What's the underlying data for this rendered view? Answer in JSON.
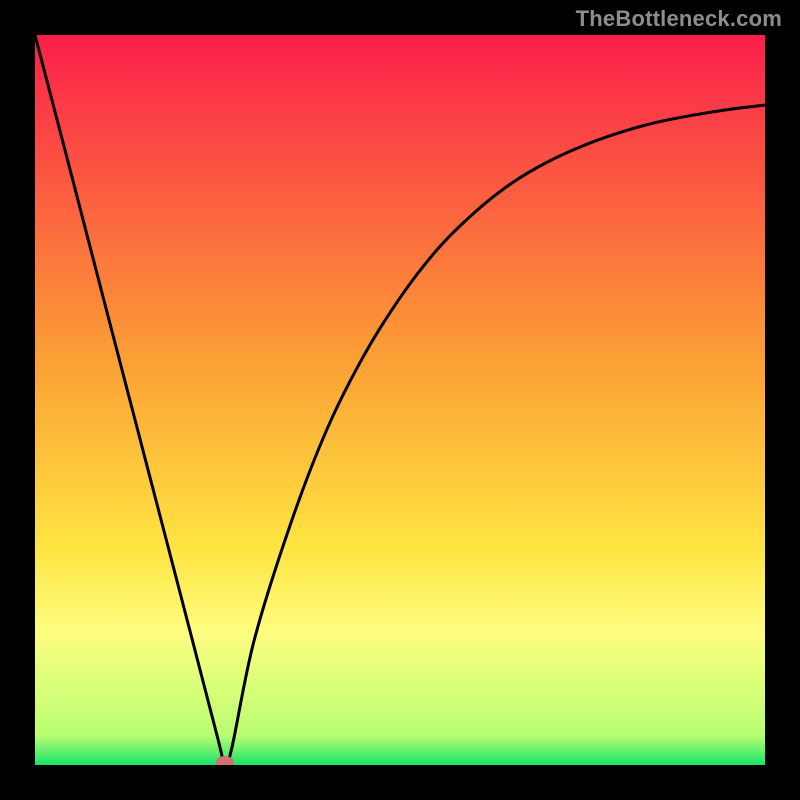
{
  "watermark": "TheBottleneck.com",
  "chart_data": {
    "type": "line",
    "title": "",
    "xlabel": "",
    "ylabel": "",
    "xlim": [
      0,
      100
    ],
    "ylim": [
      0,
      100
    ],
    "minimum_marker": {
      "x": 26,
      "y": 0,
      "color": "#d07070"
    },
    "background_gradient": {
      "stops": [
        {
          "pos": 0.0,
          "color": "#fb1f4b"
        },
        {
          "pos": 0.45,
          "color": "#fba135"
        },
        {
          "pos": 0.7,
          "color": "#ffe441"
        },
        {
          "pos": 0.82,
          "color": "#fdfd80"
        },
        {
          "pos": 0.96,
          "color": "#b8ff72"
        },
        {
          "pos": 1.0,
          "color": "#18e36a"
        }
      ]
    },
    "series": [
      {
        "name": "curve",
        "x": [
          0,
          5,
          10,
          15,
          20,
          25,
          26,
          27,
          30,
          35,
          40,
          45,
          50,
          55,
          60,
          65,
          70,
          75,
          80,
          85,
          90,
          95,
          100
        ],
        "y": [
          100,
          80.8,
          61.5,
          42.3,
          23.1,
          3.8,
          0,
          2.5,
          17,
          33,
          46,
          56,
          64,
          70.5,
          75.5,
          79.5,
          82.5,
          84.8,
          86.6,
          88,
          89,
          89.8,
          90.4
        ]
      }
    ]
  }
}
